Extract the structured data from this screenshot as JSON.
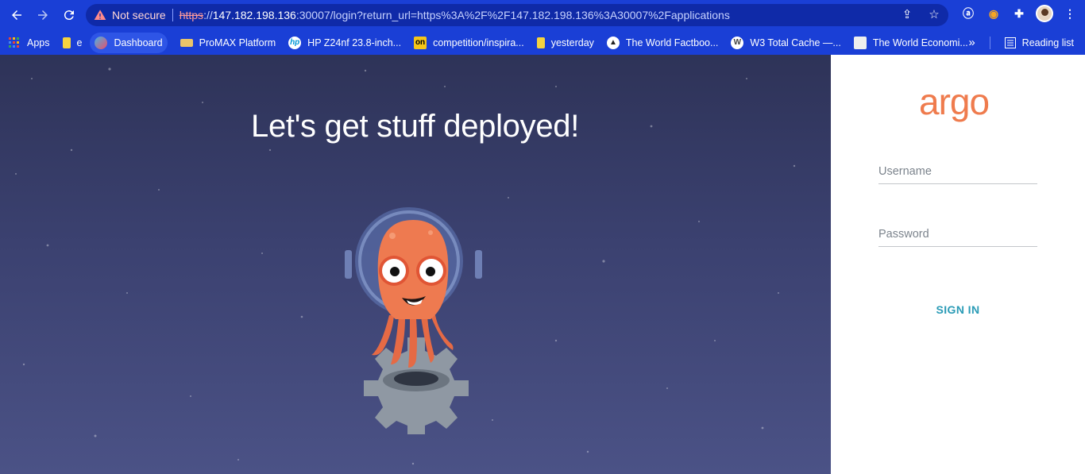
{
  "browser": {
    "not_secure": "Not secure",
    "url_scheme": "https",
    "url_sep": "://",
    "url_host": "147.182.198.136",
    "url_rest": ":30007/login?return_url=https%3A%2F%2F147.182.198.136%3A30007%2Fapplications"
  },
  "bookmarks": [
    {
      "label": "Apps",
      "icon": "apps-grid-icon"
    },
    {
      "label": "e",
      "icon": "yellow-folder-icon"
    },
    {
      "label": "Dashboard",
      "icon": "dashboard-icon"
    },
    {
      "label": "ProMAX Platform",
      "icon": "promax-icon"
    },
    {
      "label": "HP Z24nf 23.8-inch...",
      "icon": "hp-icon"
    },
    {
      "label": "competition/inspira...",
      "icon": "on-icon"
    },
    {
      "label": "yesterday",
      "icon": "yellow-folder-icon"
    },
    {
      "label": "The World Factboo...",
      "icon": "cia-icon"
    },
    {
      "label": "W3 Total Cache —...",
      "icon": "wordpress-icon"
    },
    {
      "label": "The World Economi...",
      "icon": "wef-icon"
    }
  ],
  "reading_list": "Reading list",
  "more_chevron": "»",
  "hero": {
    "headline": "Let's get stuff deployed!"
  },
  "login": {
    "logo": "argo",
    "username_placeholder": "Username",
    "password_placeholder": "Password",
    "sign_in": "SIGN IN"
  },
  "colors": {
    "browser_bar": "#1a3fd6",
    "argo_orange": "#ef7b4d",
    "sign_in_teal": "#2a9bb6"
  }
}
